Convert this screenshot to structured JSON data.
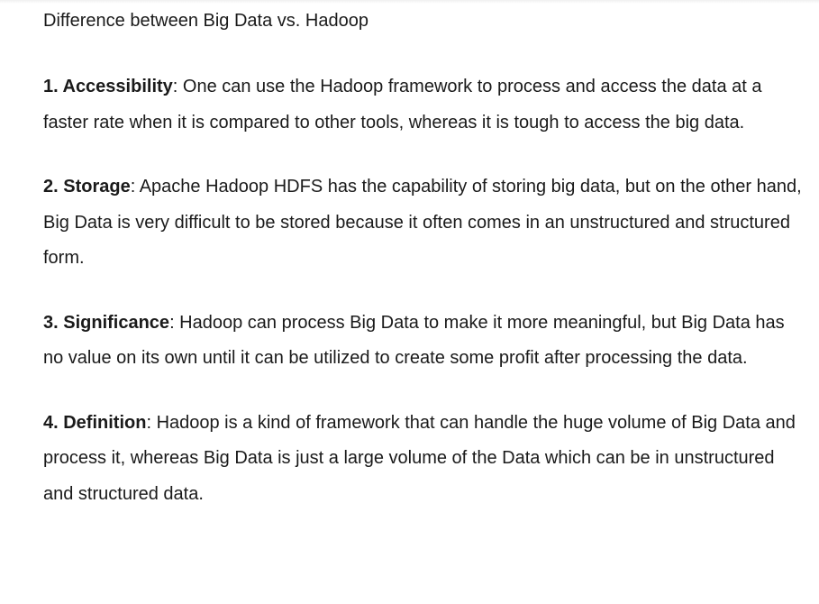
{
  "document": {
    "title": "Difference between Big Data vs. Hadoop",
    "sections": [
      {
        "term": "1. Accessibility",
        "text": ": One can use the Hadoop framework to process and access the data at a faster rate when it is compared to other tools, whereas it is tough to access the big data."
      },
      {
        "term": "2. Storage",
        "text": ": Apache Hadoop HDFS has the capability of storing big data, but on the other hand, Big Data is very difficult to be stored because it often comes in an unstructured and structured form."
      },
      {
        "term": "3. Significance",
        "text": ": Hadoop can process Big Data to make it more meaningful, but Big Data has no value on its own until it can be utilized to create some profit after processing the data."
      },
      {
        "term": "4. Definition",
        "text": ": Hadoop is a kind of framework that can handle the huge volume of Big Data and process it, whereas Big Data is just a large volume of the Data which can be in unstructured and structured data."
      }
    ]
  }
}
